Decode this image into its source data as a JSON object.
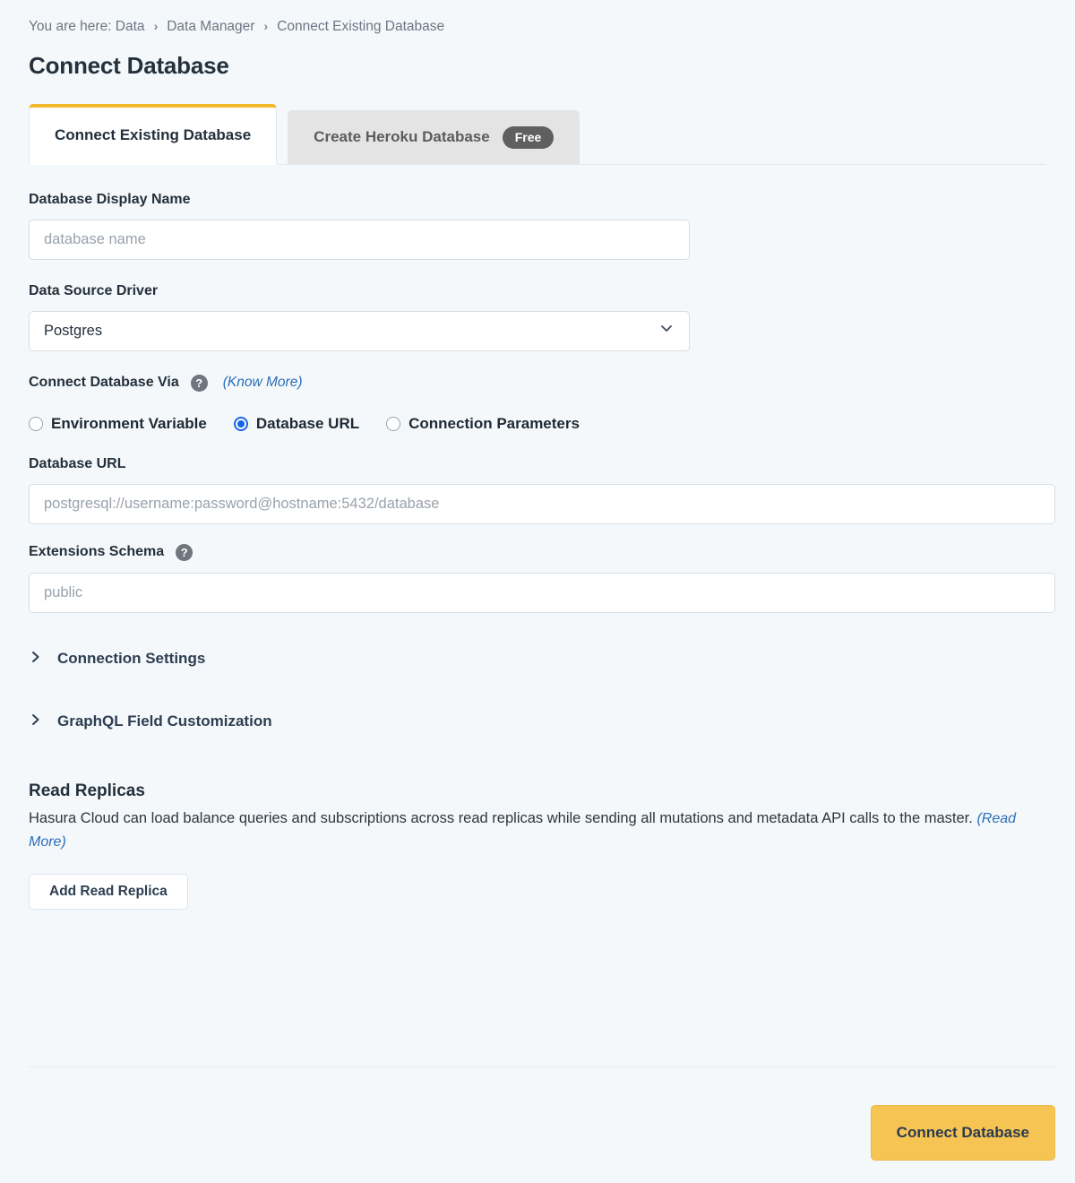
{
  "breadcrumb": {
    "prefix": "You are here: Data",
    "separator": "›",
    "items": [
      {
        "label": "Data Manager"
      },
      {
        "label": "Connect Existing Database"
      }
    ]
  },
  "page_title": "Connect Database",
  "tabs": [
    {
      "label": "Connect Existing Database",
      "active": true,
      "badge": null
    },
    {
      "label": "Create Heroku Database",
      "active": false,
      "badge": "Free"
    }
  ],
  "form": {
    "display_name": {
      "label": "Database Display Name",
      "placeholder": "database name",
      "value": ""
    },
    "driver": {
      "label": "Data Source Driver",
      "selected": "Postgres",
      "icon": "chevron-down-icon"
    },
    "connect_via": {
      "label": "Connect Database Via",
      "help_icon": "help-circle-icon",
      "know_more": "(Know More)",
      "options": [
        {
          "label": "Environment Variable",
          "selected": false
        },
        {
          "label": "Database URL",
          "selected": true
        },
        {
          "label": "Connection Parameters",
          "selected": false
        }
      ]
    },
    "database_url": {
      "label": "Database URL",
      "placeholder": "postgresql://username:password@hostname:5432/database",
      "value": ""
    },
    "extensions_schema": {
      "label": "Extensions Schema",
      "help_icon": "help-circle-icon",
      "placeholder": "public",
      "value": ""
    },
    "collapsibles": [
      {
        "label": "Connection Settings",
        "icon": "chevron-right-icon"
      },
      {
        "label": "GraphQL Field Customization",
        "icon": "chevron-right-icon"
      }
    ]
  },
  "read_replicas": {
    "title": "Read Replicas",
    "description": "Hasura Cloud can load balance queries and subscriptions across read replicas while sending all mutations and metadata API calls to the master.",
    "read_more": "(Read More)",
    "add_button": "Add Read Replica"
  },
  "footer": {
    "primary_button": "Connect Database"
  },
  "colors": {
    "page_background": "#f4f8fa",
    "accent_yellow": "#f5c452",
    "tab_active_border": "#f5b72b",
    "radio_selected": "#1565e6",
    "link_blue": "#2a6eb8",
    "badge_gray": "#5f5f5f",
    "text_dark": "#24303c"
  }
}
